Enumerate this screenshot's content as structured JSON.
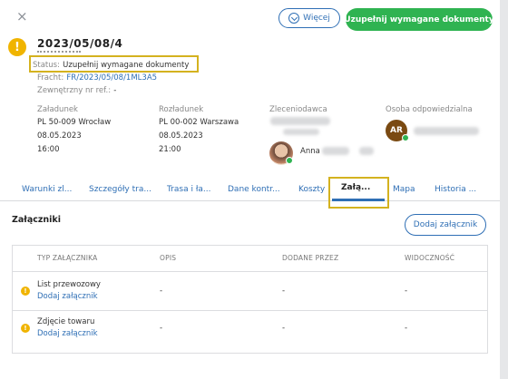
{
  "header": {
    "close_glyph": "×",
    "more_button": "Więcej",
    "primary_button": "Uzupełnij wymagane dokumenty",
    "order_id": "2023/05/08/4",
    "status_label": "Status:",
    "status_value": "Uzupełnij wymagane dokumenty",
    "freight_label": "Fracht:",
    "freight_value": "FR/2023/05/08/1ML3A5",
    "external_label": "Zewnętrzny nr ref.:",
    "external_value": "-"
  },
  "details": {
    "loading": {
      "label": "Załadunek",
      "address": "PL 50-009 Wrocław",
      "date": "08.05.2023",
      "time": "16:00"
    },
    "unloading": {
      "label": "Rozładunek",
      "address": "PL 00-002 Warszawa",
      "date": "08.05.2023",
      "time": "21:00"
    },
    "client": {
      "label": "Zleceniodawca",
      "person": "Anna"
    },
    "responsible": {
      "label": "Osoba odpowiedzialna",
      "initials": "AR"
    }
  },
  "tabs": [
    {
      "label": "Warunki zl..."
    },
    {
      "label": "Szczegóły tra..."
    },
    {
      "label": "Trasa i ła..."
    },
    {
      "label": "Dane kontr..."
    },
    {
      "label": "Koszty"
    },
    {
      "label": "Załą..."
    },
    {
      "label": "Mapa"
    },
    {
      "label": "Historia ..."
    }
  ],
  "attachments": {
    "title": "Załączniki",
    "add_button": "Dodaj załącznik",
    "columns": [
      "TYP ZAŁĄCZNIKA",
      "OPIS",
      "DODANE PRZEZ",
      "WIDOCZNOŚĆ"
    ],
    "rows": [
      {
        "type": "List przewozowy",
        "action": "Dodaj załącznik",
        "description": "-",
        "added_by": "-",
        "visibility": "-"
      },
      {
        "type": "Zdjęcie towaru",
        "action": "Dodaj załącznik",
        "description": "-",
        "added_by": "-",
        "visibility": "-"
      }
    ]
  },
  "colors": {
    "accent": "#2f6fb5",
    "success": "#2fb351",
    "warning": "#f0b400",
    "highlight": "#d4b21f"
  }
}
